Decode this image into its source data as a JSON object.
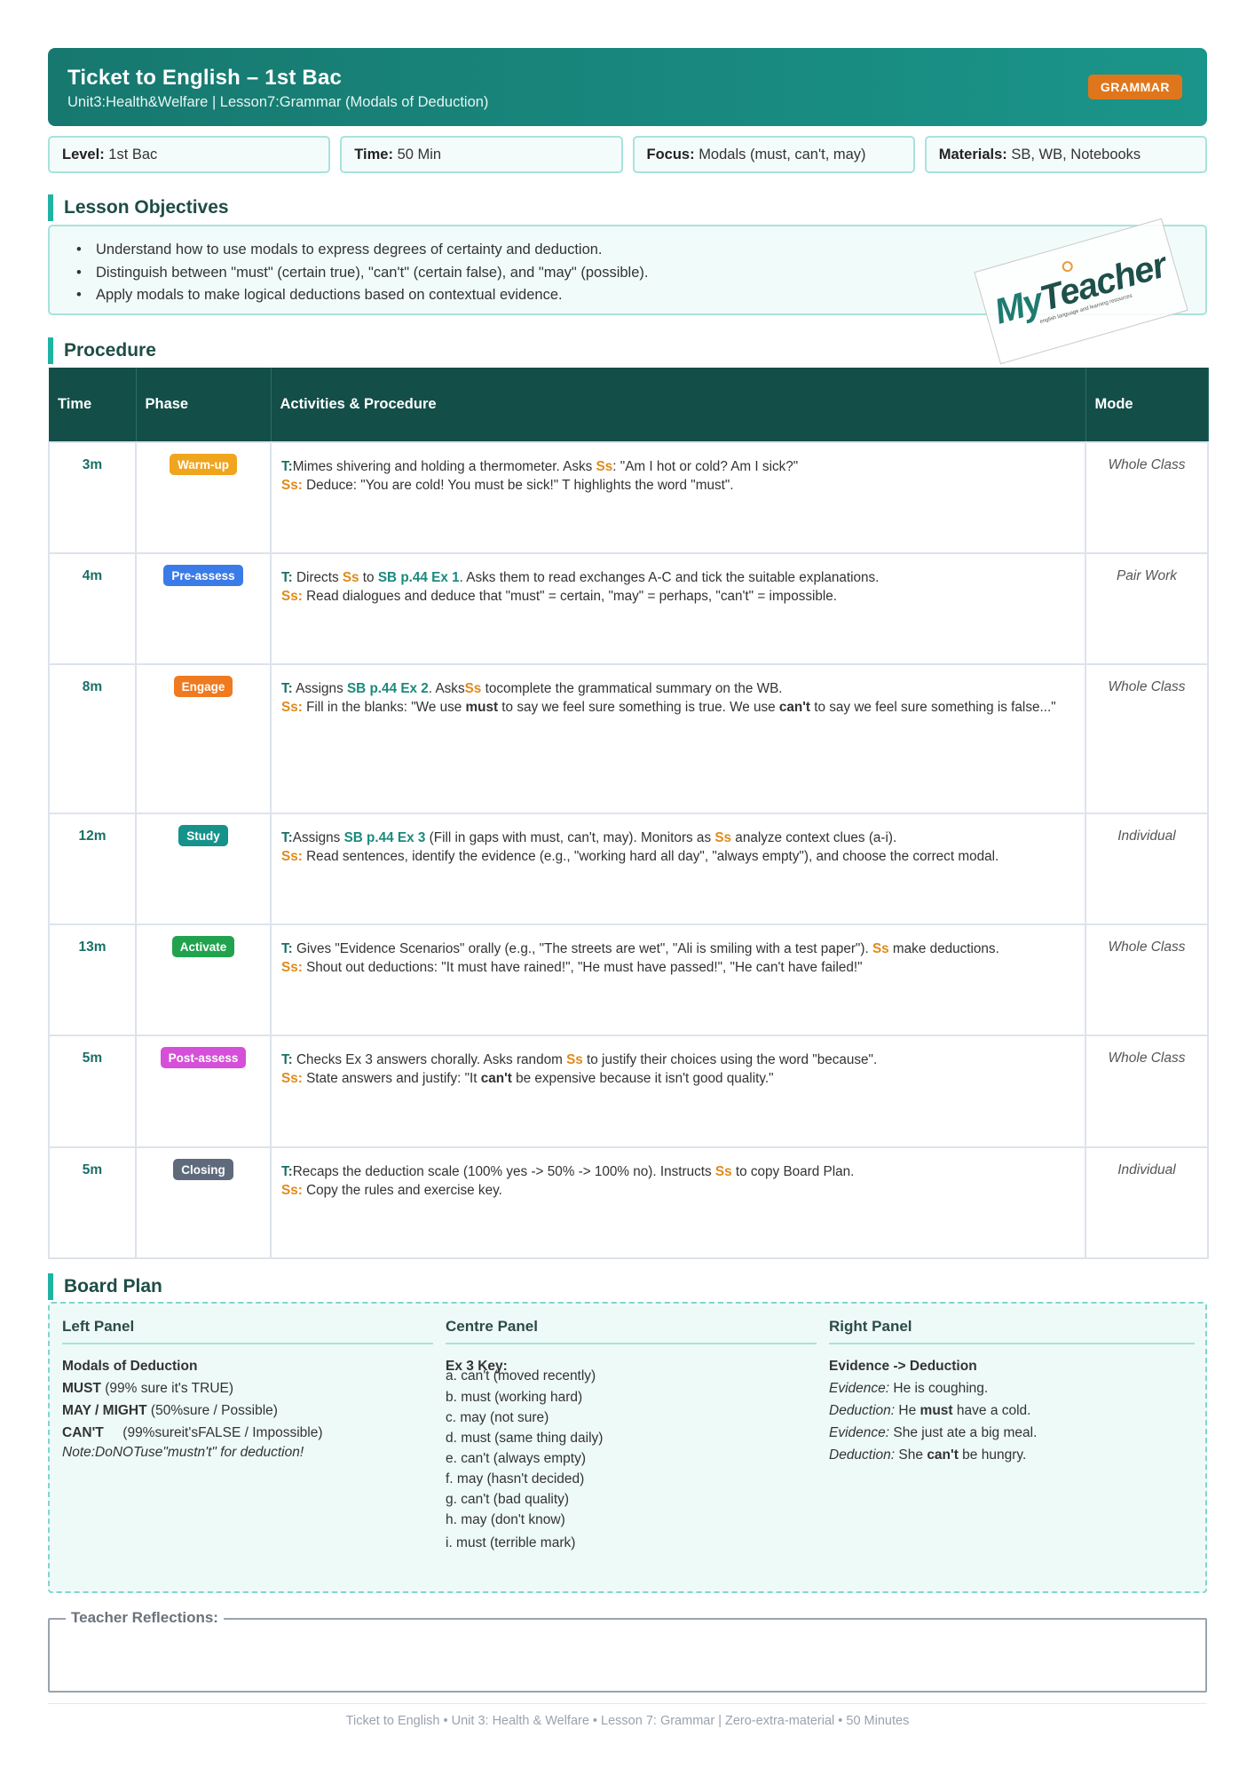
{
  "header": {
    "title": "Ticket to English – 1st Bac",
    "subtitle": "Unit3:Health&Welfare | Lesson7:Grammar (Modals of Deduction)",
    "badge": "GRAMMAR"
  },
  "info": [
    {
      "label": "Level:",
      "value": "1st Bac"
    },
    {
      "label": "Time:",
      "value": "50 Min"
    },
    {
      "label": "Focus:",
      "value": "Modals (must, can't, may)"
    },
    {
      "label": "Materials:",
      "value": "SB, WB, Notebooks"
    }
  ],
  "objectives": {
    "title": "Lesson Objectives",
    "items": [
      "Understand how to use modals to express degrees of certainty and deduction.",
      "Distinguish between \"must\" (certain true), \"can't\" (certain false), and \"may\" (possible).",
      "Apply modals to make logical deductions based on contextual evidence."
    ]
  },
  "logo": {
    "part1": "My",
    "part2": "Teacher",
    "tagline": "english language and learning resources"
  },
  "procedure": {
    "title": "Procedure",
    "headers": {
      "time": "Time",
      "phase": "Phase",
      "activities": "Activities & Procedure",
      "mode": "Mode"
    },
    "labels": {
      "t": "T:",
      "ss": "Ss:",
      "ss_word": "Ss"
    },
    "rows": [
      {
        "time": "3m",
        "phase": "Warm-up",
        "color": "#f0a51e",
        "mode": "Whole Class",
        "t1": "Mimes shivering and holding a thermometer. Asks ",
        "t2": ": \"Am I hot or cold? Am I sick?\"",
        "ss": "Deduce: \"You are cold! You must be sick!\" T highlights the word \"must\"."
      },
      {
        "time": "4m",
        "phase": "Pre-assess",
        "color": "#3b7be8",
        "mode": "Pair Work",
        "t1": "Directs ",
        "t2": " to ",
        "ref": "SB p.44 Ex 1",
        "t3": ". Asks them to read exchanges A-C and tick the suitable explanations.",
        "ss": "Read dialogues and deduce that \"must\" = certain, \"may\" = perhaps, \"can't\" = impossible."
      },
      {
        "time": "8m",
        "phase": "Engage",
        "color": "#ef7a20",
        "mode": "Whole Class",
        "t1": "Assigns ",
        "ref": "SB p.44 Ex 2",
        "t2": ". Asks",
        "t3": " tocomplete the grammatical summary on the WB.",
        "ss1": "Fill in the blanks: \"We use ",
        "ss_b1": "must",
        "ss2": " to say we feel sure something is true. We use ",
        "ss_b2": "can't",
        "ss3": " to say we feel sure something is false...\""
      },
      {
        "time": "12m",
        "phase": "Study",
        "color": "#15938a",
        "mode": "Individual",
        "t1": "Assigns ",
        "ref": "SB p.44 Ex 3",
        "t2": " (Fill in gaps with must, can't, may). Monitors as ",
        "t3": " analyze context clues (a-i).",
        "ss": "Read sentences, identify the evidence (e.g., \"working hard all day\", \"always empty\"), and choose the correct modal."
      },
      {
        "time": "13m",
        "phase": "Activate",
        "color": "#21a34e",
        "mode": "Whole Class",
        "t1": "Gives \"Evidence Scenarios\" orally (e.g., \"The streets are wet\", \"Ali is smiling with a test paper\"). ",
        "t2": " make deductions.",
        "ss": "Shout out deductions: \"It must have rained!\", \"He must have passed!\", \"He can't have failed!\""
      },
      {
        "time": "5m",
        "phase": "Post-assess",
        "color": "#d64fd8",
        "mode": "Whole Class",
        "t1": "Checks Ex 3 answers chorally. Asks random ",
        "t2": " to justify their choices using the word \"because\".",
        "ss1": "State answers and justify: \"It ",
        "ss_b1": "can't",
        "ss2": " be expensive because it isn't good quality.\""
      },
      {
        "time": "5m",
        "phase": "Closing",
        "color": "#5f6b7c",
        "mode": "Individual",
        "t1": "Recaps the deduction scale (100% yes -> 50% -> 100% no). Instructs ",
        "t2": " to copy Board Plan.",
        "ss": "Copy the rules and exercise key."
      }
    ]
  },
  "board": {
    "title": "Board Plan",
    "left": {
      "head": "Left Panel",
      "subhead": "Modals of Deduction",
      "lines": [
        {
          "b": "MUST",
          "t": " (99% sure it's TRUE)"
        },
        {
          "b": "MAY / MIGHT",
          "t": " (50%sure / Possible)"
        },
        {
          "b": "CAN'T",
          "t": "     (99%sureit'sFALSE / Impossible)"
        }
      ],
      "note": "Note:DoNOTuse\"mustn't\" for deduction!"
    },
    "centre": {
      "head": "Centre Panel",
      "subhead": "Ex 3 Key:",
      "items": [
        "a. can't (moved recently)",
        "b. must (working hard)",
        "c. may (not sure)",
        "d. must (same thing daily)",
        "e. can't (always empty)",
        "f. may (hasn't decided)",
        "g. can't (bad quality)",
        "h. may (don't know)",
        "i. must (terrible mark)"
      ]
    },
    "right": {
      "head": "Right Panel",
      "subhead": "Evidence -> Deduction",
      "lines": [
        {
          "i": "Evidence:",
          "t1": " He is coughing.",
          "b": "",
          "t2": ""
        },
        {
          "i": "Deduction:",
          "t1": " He ",
          "b": "must",
          "t2": " have a cold."
        },
        {
          "i": "Evidence:",
          "t1": " She just ate a big meal.",
          "b": "",
          "t2": ""
        },
        {
          "i": "Deduction:",
          "t1": " She ",
          "b": "can't",
          "t2": " be hungry."
        }
      ]
    }
  },
  "reflections": {
    "label": "Teacher Reflections:"
  },
  "footer": "Ticket to English • Unit 3: Health & Welfare • Lesson 7: Grammar | Zero-extra-material • 50 Minutes",
  "colors": {
    "brand": "#17786f",
    "accent": "#e0761b",
    "table_header": "#134f48",
    "teacher_label": "#1b6f66",
    "student_label": "#e08a1a"
  }
}
